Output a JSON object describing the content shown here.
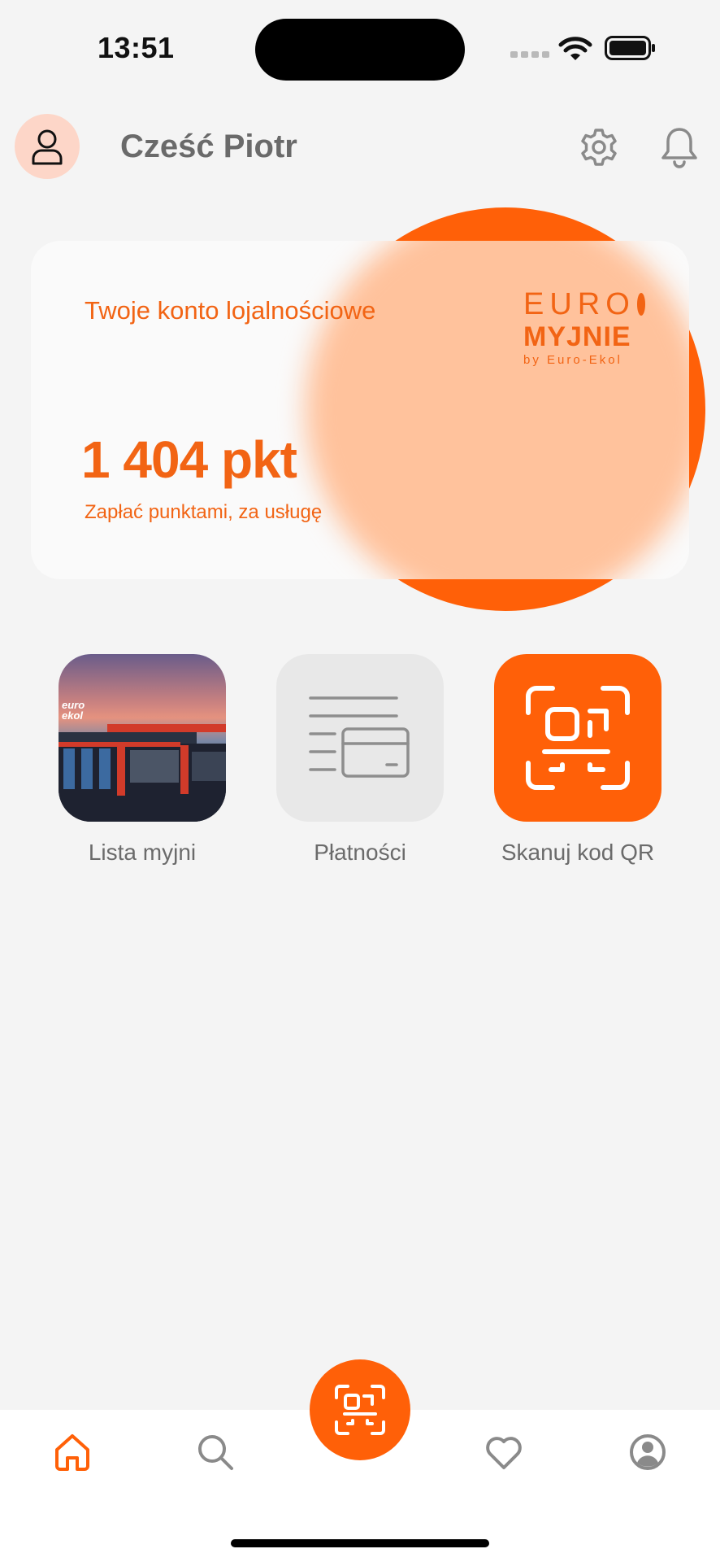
{
  "status_bar": {
    "time": "13:51"
  },
  "header": {
    "greeting": "Cześć Piotr"
  },
  "loyalty_card": {
    "title": "Twoje konto lojalnościowe",
    "points": "1 404 pkt",
    "subtitle": "Zapłać punktami, za usługę",
    "logo": {
      "line1": "EURO",
      "line2": "MYJNIE",
      "line3": "by Euro-Ekol"
    }
  },
  "tiles": [
    {
      "label": "Lista myjni",
      "image_text": "euro ekol"
    },
    {
      "label": "Płatności"
    },
    {
      "label": "Skanuj kod QR"
    }
  ],
  "bottom_nav": {
    "items": [
      {
        "icon": "home-icon",
        "active": true
      },
      {
        "icon": "search-icon",
        "active": false
      },
      {
        "icon": "qr-scan-icon",
        "active": false
      },
      {
        "icon": "heart-icon",
        "active": false
      },
      {
        "icon": "profile-icon",
        "active": false
      }
    ]
  },
  "colors": {
    "accent": "#ff6008",
    "text_orange": "#f26414",
    "background": "#f4f4f4"
  }
}
